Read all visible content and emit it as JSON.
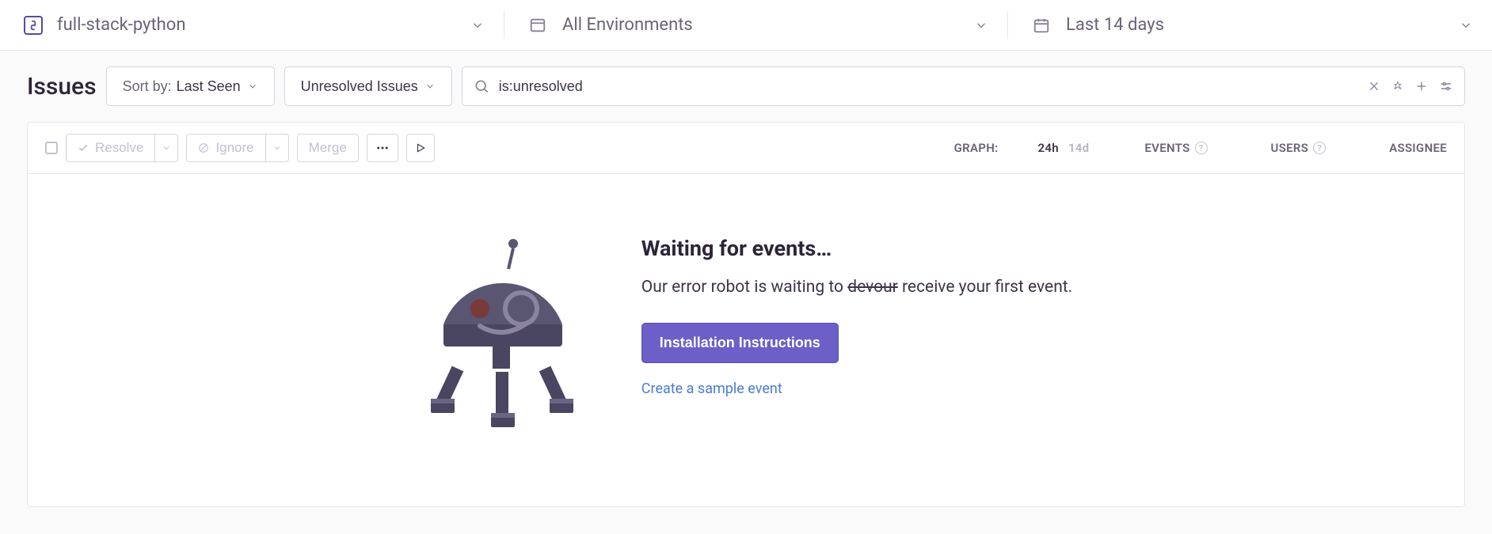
{
  "topbar": {
    "project": "full-stack-python",
    "environment": "All Environments",
    "dateRange": "Last 14 days"
  },
  "page": {
    "title": "Issues"
  },
  "sort": {
    "label": "Sort by:",
    "value": "Last Seen"
  },
  "filter": {
    "value": "Unresolved Issues"
  },
  "search": {
    "value": "is:unresolved"
  },
  "actions": {
    "resolve": "Resolve",
    "ignore": "Ignore",
    "merge": "Merge"
  },
  "columns": {
    "graph": "GRAPH:",
    "range_current": "24h",
    "range_other": "14d",
    "events": "EVENTS",
    "users": "USERS",
    "assignee": "ASSIGNEE"
  },
  "empty": {
    "title": "Waiting for events…",
    "desc_pre": "Our error robot is waiting to ",
    "desc_strike": "devour",
    "desc_post": " receive your first event.",
    "button": "Installation Instructions",
    "link": "Create a sample event"
  }
}
